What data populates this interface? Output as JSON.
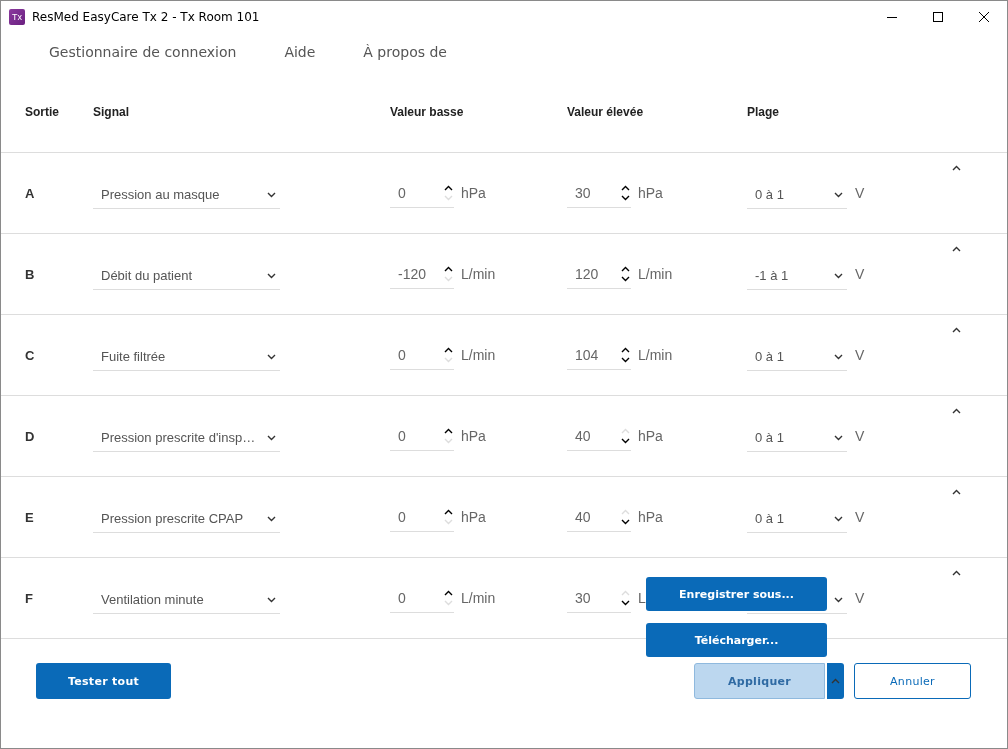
{
  "window": {
    "logo": "Tx",
    "title": "ResMed EasyCare Tx 2 - Tx Room 101"
  },
  "menu": [
    "Gestionnaire de connexion",
    "Aide",
    "À propos de"
  ],
  "columns": [
    "Sortie",
    "Signal",
    "Valeur basse",
    "Valeur élevée",
    "Plage"
  ],
  "rows": [
    {
      "output": "A",
      "signal": "Pression au masque",
      "low": {
        "value": "0",
        "unit": "hPa",
        "up_disabled": false,
        "down_disabled": true
      },
      "high": {
        "value": "30",
        "unit": "hPa",
        "up_disabled": false,
        "down_disabled": false
      },
      "range": "0 à 1",
      "range_unit": "V",
      "expanded": true
    },
    {
      "output": "B",
      "signal": "Débit du patient",
      "low": {
        "value": "-120",
        "unit": "L/min",
        "up_disabled": false,
        "down_disabled": true
      },
      "high": {
        "value": "120",
        "unit": "L/min",
        "up_disabled": false,
        "down_disabled": false
      },
      "range": "-1 à 1",
      "range_unit": "V",
      "expanded": true
    },
    {
      "output": "C",
      "signal": "Fuite filtrée",
      "low": {
        "value": "0",
        "unit": "L/min",
        "up_disabled": false,
        "down_disabled": true
      },
      "high": {
        "value": "104",
        "unit": "L/min",
        "up_disabled": false,
        "down_disabled": false
      },
      "range": "0 à 1",
      "range_unit": "V",
      "expanded": true
    },
    {
      "output": "D",
      "signal": "Pression prescrite d'insp…",
      "low": {
        "value": "0",
        "unit": "hPa",
        "up_disabled": false,
        "down_disabled": true
      },
      "high": {
        "value": "40",
        "unit": "hPa",
        "up_disabled": true,
        "down_disabled": false
      },
      "range": "0 à 1",
      "range_unit": "V",
      "expanded": true
    },
    {
      "output": "E",
      "signal": "Pression prescrite CPAP",
      "low": {
        "value": "0",
        "unit": "hPa",
        "up_disabled": false,
        "down_disabled": true
      },
      "high": {
        "value": "40",
        "unit": "hPa",
        "up_disabled": true,
        "down_disabled": false
      },
      "range": "0 à 1",
      "range_unit": "V",
      "expanded": true
    },
    {
      "output": "F",
      "signal": "Ventilation minute",
      "low": {
        "value": "0",
        "unit": "L/min",
        "up_disabled": false,
        "down_disabled": true
      },
      "high": {
        "value": "30",
        "unit": "L",
        "up_disabled": true,
        "down_disabled": false
      },
      "range_unit": "V",
      "expanded": true
    }
  ],
  "footer": {
    "test_button": "Tester tout",
    "apply_button": {
      "label": "Appliquer",
      "disabled": true,
      "menu_open": true
    },
    "cancel_button": "Annuler"
  },
  "apply_menu": [
    "Enregistrer sous...",
    "Télécharger..."
  ]
}
